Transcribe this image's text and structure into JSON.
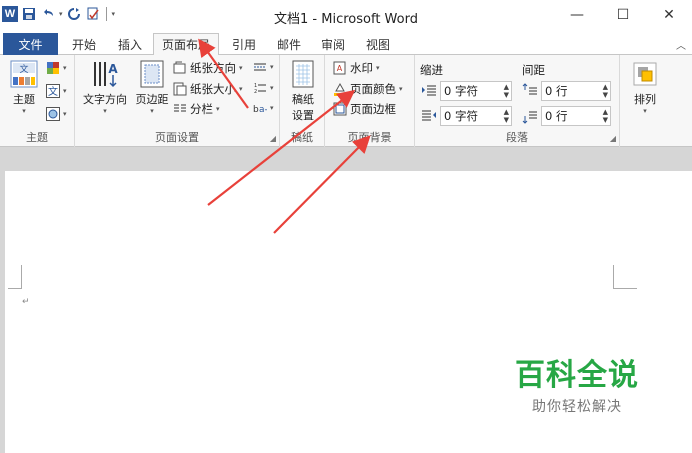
{
  "window": {
    "title": "文档1 - Microsoft Word",
    "controls": {
      "minimize": "—",
      "maximize": "☐",
      "close": "✕"
    }
  },
  "qat": {
    "undo_icon": "undo-icon",
    "redo_icon": "redo-icon",
    "save_icon": "save-icon",
    "customize_icon": "customize-qat-icon"
  },
  "tabs": [
    "文件",
    "开始",
    "插入",
    "页面布局",
    "引用",
    "邮件",
    "审阅",
    "视图"
  ],
  "active_tab": "页面布局",
  "ribbon": {
    "themes": {
      "label": "主题",
      "themes_btn": "主题"
    },
    "page_setup": {
      "label": "页面设置",
      "text_direction": "文字方向",
      "margins": "页边距",
      "orientation": "纸张方向",
      "size": "纸张大小",
      "columns": "分栏"
    },
    "manuscript": {
      "label": "稿纸",
      "manuscript_setup_line1": "稿纸",
      "manuscript_setup_line2": "设置"
    },
    "page_background": {
      "label": "页面背景",
      "watermark": "水印",
      "page_color": "页面颜色",
      "page_borders": "页面边框"
    },
    "paragraph": {
      "label": "段落",
      "indent_label": "缩进",
      "spacing_label": "间距",
      "indent_left": "0 字符",
      "indent_right": "0 字符",
      "spacing_before": "0 行",
      "spacing_after": "0 行"
    },
    "arrange": {
      "label": "排列"
    }
  },
  "document": {
    "paragraph_mark": "↵"
  },
  "watermark_overlay": {
    "main": "百科全说",
    "sub": "助你轻松解决"
  },
  "colors": {
    "file_tab": "#2b579a",
    "annotation_arrow": "#e8413a",
    "watermark_green": "#27a745"
  }
}
